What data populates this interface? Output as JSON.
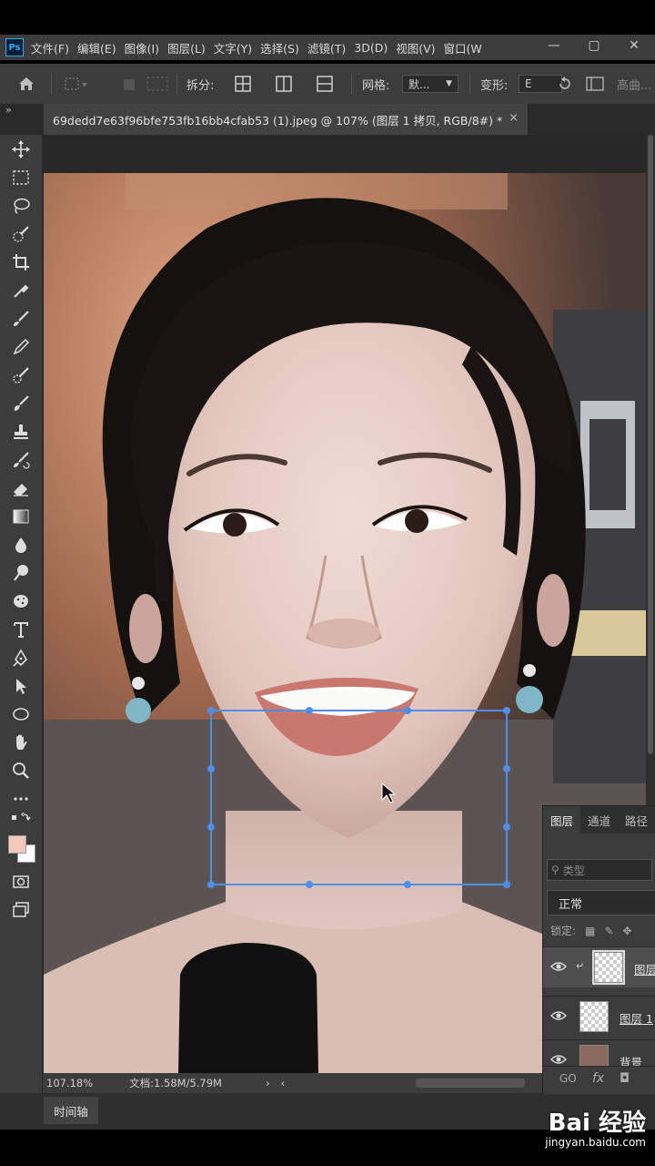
{
  "app": {
    "logo_text": "Ps"
  },
  "menu": [
    "文件(F)",
    "编辑(E)",
    "图像(I)",
    "图层(L)",
    "文字(Y)",
    "选择(S)",
    "滤镜(T)",
    "3D(D)",
    "视图(V)",
    "窗口(W"
  ],
  "window_controls": {
    "minimize": "—",
    "restore": "▢",
    "close": "✕"
  },
  "options_bar": {
    "split_label": "拆分:",
    "grid_label": "网格:",
    "grid_value": "默...",
    "warp_label": "变形:",
    "warp_value": "E",
    "trailing_label": "高曲..."
  },
  "document_tab": {
    "title": "69dedd7e63f96bfe753fb16bb4cfab53 (1).jpeg @ 107% (图层 1 拷贝, RGB/8#) *",
    "close": "×",
    "collapse": "»"
  },
  "status_bar": {
    "zoom": "107.18%",
    "doc_info": "文档:1.58M/5.79M",
    "arrow": "›",
    "left_arrow": "‹"
  },
  "timeline": {
    "label": "时间轴"
  },
  "layers_panel": {
    "tabs": [
      "图层",
      "通道",
      "路径"
    ],
    "search_placeholder": "类型",
    "blend_mode": "正常",
    "lock_label": "锁定:",
    "layers": [
      {
        "name": "图层",
        "selected": true
      },
      {
        "name": "图层 1",
        "selected": false
      },
      {
        "name": "背景",
        "selected": false
      }
    ],
    "footer_link": "GO",
    "footer_fx": "fx"
  },
  "watermark": {
    "logo": "Bai 经验",
    "url": "jingyan.baidu.com"
  },
  "colors": {
    "foreground": "#f2c9bc",
    "background": "#ffffff",
    "selection": "#4d8ee8",
    "panel": "#3c3c3c"
  }
}
